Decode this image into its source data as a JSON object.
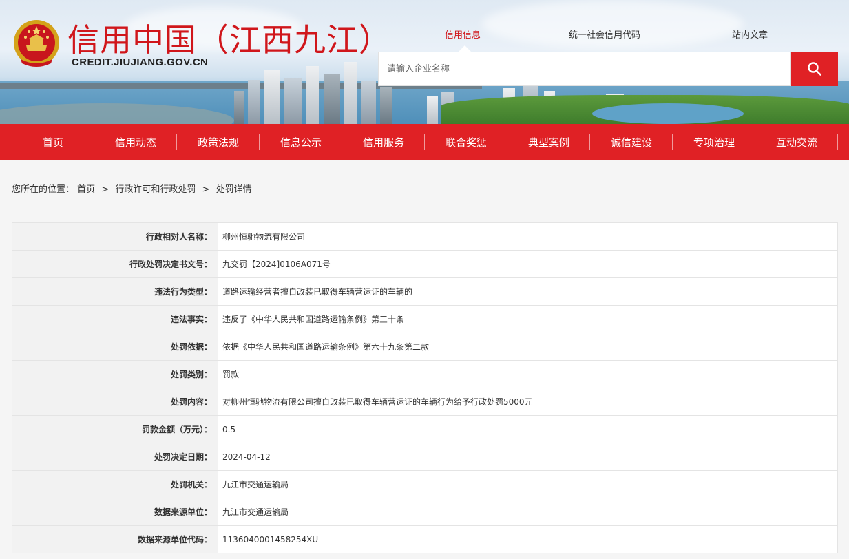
{
  "site": {
    "title": "信用中国（江西九江）",
    "domain": "CREDIT.JIUJIANG.GOV.CN"
  },
  "top_tabs": [
    {
      "label": "信用信息",
      "active": true
    },
    {
      "label": "统一社会信用代码",
      "active": false
    },
    {
      "label": "站内文章",
      "active": false
    }
  ],
  "search": {
    "placeholder": "请输入企业名称",
    "icon": "search-icon"
  },
  "nav": [
    {
      "label": "首页"
    },
    {
      "label": "信用动态"
    },
    {
      "label": "政策法规"
    },
    {
      "label": "信息公示"
    },
    {
      "label": "信用服务"
    },
    {
      "label": "联合奖惩"
    },
    {
      "label": "典型案例"
    },
    {
      "label": "诚信建设"
    },
    {
      "label": "专项治理"
    },
    {
      "label": "互动交流"
    }
  ],
  "breadcrumb": {
    "prefix": "您所在的位置：",
    "items": [
      "首页",
      "行政许可和行政处罚",
      "处罚详情"
    ],
    "separator": ">"
  },
  "details": [
    {
      "label": "行政相对人名称：",
      "value": "柳州恒驰物流有限公司"
    },
    {
      "label": "行政处罚决定书文号：",
      "value": "九交罚【2024]0106A071号"
    },
    {
      "label": "违法行为类型：",
      "value": "道路运输经营者擅自改装已取得车辆营运证的车辆的"
    },
    {
      "label": "违法事实：",
      "value": "违反了《中华人民共和国道路运输条例》第三十条"
    },
    {
      "label": "处罚依据：",
      "value": "依据《中华人民共和国道路运输条例》第六十九条第二款"
    },
    {
      "label": "处罚类别：",
      "value": "罚款"
    },
    {
      "label": "处罚内容：",
      "value": "对柳州恒驰物流有限公司擅自改装已取得车辆营运证的车辆行为给予行政处罚5000元"
    },
    {
      "label": "罚款金额（万元）：",
      "value": "0.5"
    },
    {
      "label": "处罚决定日期：",
      "value": "2024-04-12"
    },
    {
      "label": "处罚机关：",
      "value": "九江市交通运输局"
    },
    {
      "label": "数据来源单位：",
      "value": "九江市交通运输局"
    },
    {
      "label": "数据来源单位代码：",
      "value": "1136040001458254XU"
    }
  ],
  "colors": {
    "brand_red": "#e02125",
    "title_red": "#d0161b"
  }
}
